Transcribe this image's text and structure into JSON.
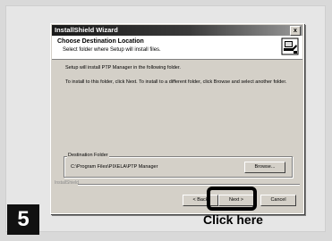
{
  "dialog": {
    "title": "InstallShield Wizard",
    "close_glyph": "x",
    "header": {
      "title": "Choose Destination Location",
      "subtitle": "Select folder where Setup will install files.",
      "icon": "installer-computer-icon"
    },
    "body_line1": "Setup will install PTP Manager in the following folder.",
    "body_line2": "To install to this folder, click Next. To install to a different folder, click Browse and select another folder.",
    "destination": {
      "label": "Destination Folder",
      "path": "C:\\Program Files\\PIXELA\\PTP Manager",
      "browse_label": "Browse..."
    },
    "footer_brand": "InstallShield",
    "buttons": {
      "back": "< Back",
      "next": "Next >",
      "cancel": "Cancel"
    }
  },
  "annotation": {
    "step_number": "5",
    "callout": "Click here"
  }
}
